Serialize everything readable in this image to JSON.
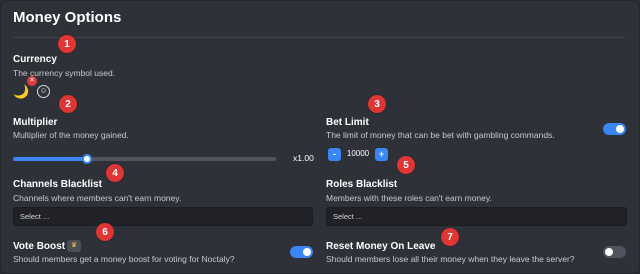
{
  "page": {
    "title": "Money Options"
  },
  "markers": [
    "1",
    "2",
    "3",
    "4",
    "5",
    "6",
    "7"
  ],
  "currency": {
    "label": "Currency",
    "description": "The currency symbol used.",
    "symbol": "🌙",
    "remove_glyph": "×",
    "add_glyph": "☺"
  },
  "multiplier": {
    "label": "Multiplier",
    "description": "Multiplier of the money gained.",
    "value_text": "x1.00",
    "slider_fraction": 0.28
  },
  "bet_limit": {
    "label": "Bet Limit",
    "description": "The limit of money that can be bet with gambling commands.",
    "enabled": true,
    "minus": "-",
    "plus": "+",
    "value": "10000"
  },
  "channels_blacklist": {
    "label": "Channels Blacklist",
    "description": "Channels where members can't earn money.",
    "placeholder": "Select ..."
  },
  "roles_blacklist": {
    "label": "Roles Blacklist",
    "description": "Members with these roles can't earn money.",
    "placeholder": "Select ..."
  },
  "vote_boost": {
    "label": "Vote Boost",
    "description": "Should members get a money boost for voting for Noctaly?",
    "premium_glyph": "♛",
    "enabled": true
  },
  "reset_money": {
    "label": "Reset Money On Leave",
    "description": "Should members lose all their money when they leave the server?",
    "enabled": false
  },
  "colors": {
    "accent": "#3a86f5",
    "marker": "#e03535",
    "background": "#2e3138",
    "input_bg": "#202227"
  }
}
